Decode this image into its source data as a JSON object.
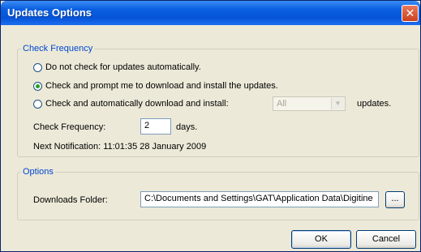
{
  "window": {
    "title": "Updates Options"
  },
  "check_frequency_group": {
    "legend": "Check Frequency",
    "options": [
      {
        "label": "Do not check for updates automatically.",
        "checked": false
      },
      {
        "label": "Check and prompt me to download and install the updates.",
        "checked": true
      },
      {
        "label": "Check and automatically download and install:",
        "checked": false
      }
    ],
    "update_type_select": {
      "value": "All",
      "enabled": false
    },
    "updates_suffix": "updates.",
    "frequency_label": "Check Frequency:",
    "frequency_value": "2",
    "frequency_unit": "days.",
    "next_notification": "Next Notification: 11:01:35 28 January 2009"
  },
  "options_group": {
    "legend": "Options",
    "downloads_folder_label": "Downloads Folder:",
    "downloads_folder_value": "C:\\Documents and Settings\\GAT\\Application Data\\Digitine",
    "browse_label": "..."
  },
  "buttons": {
    "ok": "OK",
    "cancel": "Cancel"
  },
  "colors": {
    "title_bar": "#0554d8",
    "legend_text": "#0046d5",
    "close_button": "#c9401e"
  }
}
